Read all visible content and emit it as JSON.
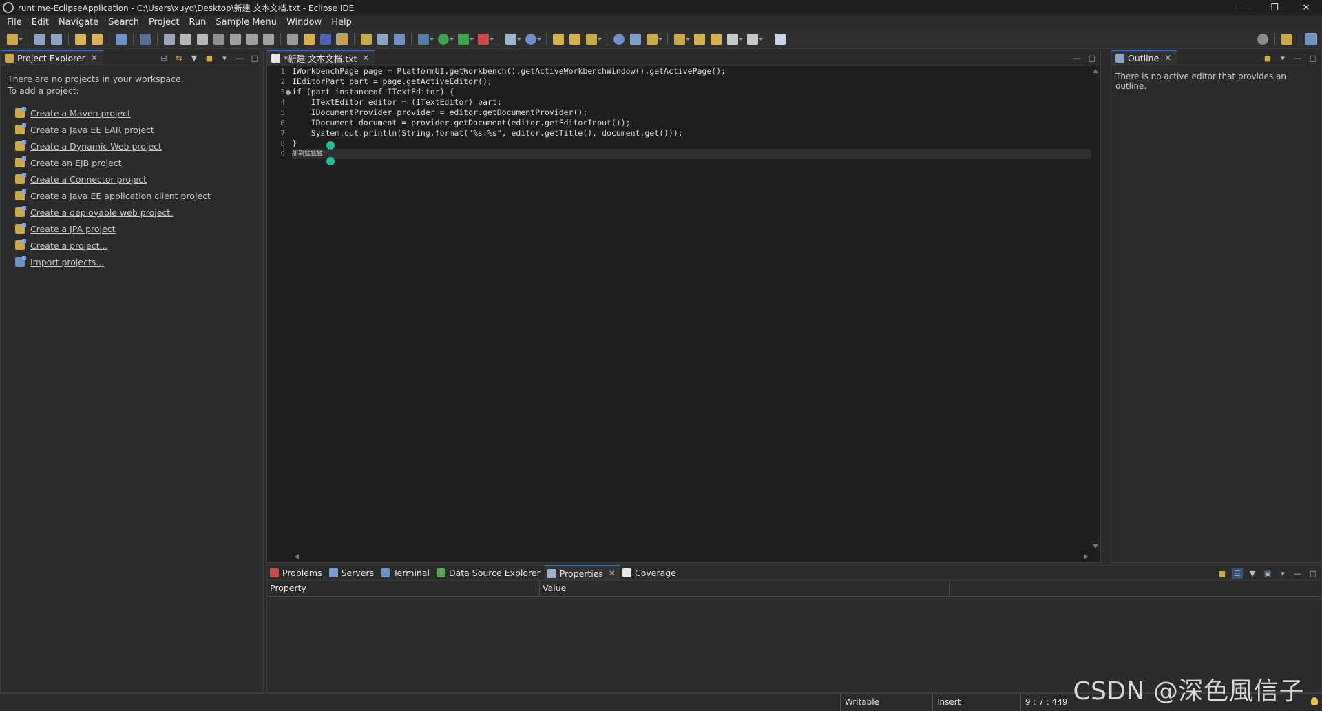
{
  "window": {
    "title": "runtime-EclipseApplication - C:\\Users\\xuyq\\Desktop\\新建 文本文档.txt - Eclipse IDE",
    "controls": [
      "—",
      "❐",
      "✕"
    ]
  },
  "menu": [
    "File",
    "Edit",
    "Navigate",
    "Search",
    "Project",
    "Run",
    "Sample Menu",
    "Window",
    "Help"
  ],
  "project_explorer": {
    "tab_label": "Project Explorer",
    "line1": "There are no projects in your workspace.",
    "line2": "To add a project:",
    "links": [
      "Create a Maven project",
      "Create a Java EE EAR project",
      "Create a Dynamic Web project",
      "Create an EJB project",
      "Create a Connector project",
      "Create a Java EE application client project",
      "Create a deployable web project.",
      "Create a JPA project",
      "Create a project...",
      "Import projects..."
    ]
  },
  "editor": {
    "tab_label": "*新建 文本文档.txt",
    "line_numbers": [
      "1",
      "2",
      "3",
      "4",
      "5",
      "6",
      "7",
      "8",
      "9"
    ],
    "lines": [
      "IWorkbenchPage page = PlatformUI.getWorkbench().getActiveWorkbenchWindow().getActivePage();",
      "IEditorPart part = page.getActiveEditor();",
      "if (part instanceof ITextEditor) {",
      "    ITextEditor editor = (ITextEditor) part;",
      "    IDocumentProvider provider = editor.getDocumentProvider();",
      "    IDocument document = provider.getDocument(editor.getEditorInput());",
      "    System.out.println(String.format(\"%s:%s\", editor.getTitle(), document.get()));",
      "}",
      "那到猛猛猛"
    ]
  },
  "outline": {
    "tab_label": "Outline",
    "message": "There is no active editor that provides an outline."
  },
  "bottom_panel": {
    "tabs": [
      "Problems",
      "Servers",
      "Terminal",
      "Data Source Explorer",
      "Properties",
      "Coverage"
    ],
    "active_tab": "Properties",
    "columns": [
      "Property",
      "Value"
    ]
  },
  "status_bar": {
    "writable": "Writable",
    "insert_mode": "Insert",
    "position": "9 : 7 : 449"
  },
  "watermark": "CSDN @深色風信子",
  "colors": {
    "background": "#2b2b2b",
    "editor_background": "#1e1e1e",
    "active_tab_accent": "#3d6ecf",
    "selection_handle": "#1bbf9a"
  }
}
